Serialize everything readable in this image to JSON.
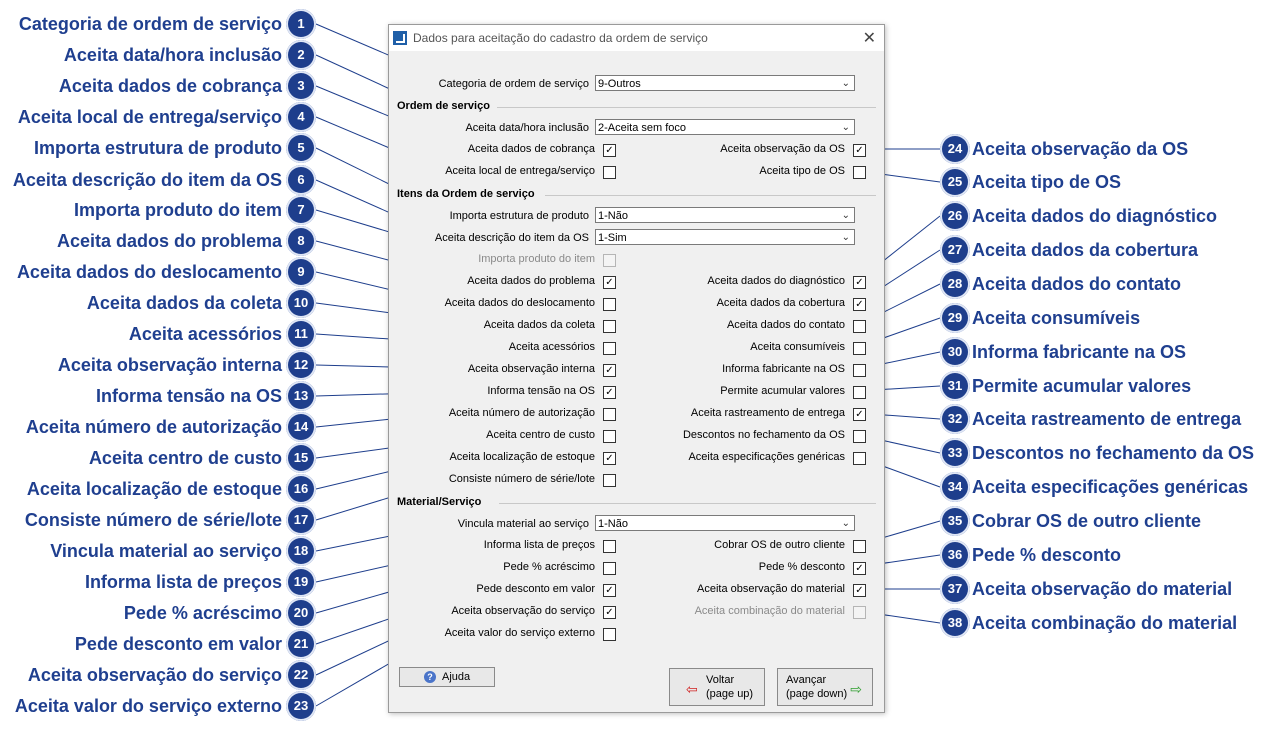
{
  "dialog": {
    "title": "Dados para aceitação do cadastro da ordem de serviço",
    "close_glyph": "✕",
    "category_label": "Categoria de ordem de serviço",
    "category_value": "9-Outros",
    "section_ordem": "Ordem de serviço",
    "section_itens": "Itens da Ordem de serviço",
    "section_material": "Material/Serviço",
    "datahora_label": "Aceita data/hora inclusão",
    "datahora_value": "2-Aceita sem foco",
    "importa_estrutura_label": "Importa estrutura de produto",
    "importa_estrutura_value": "1-Não",
    "aceita_descricao_label": "Aceita descrição do item da OS",
    "aceita_descricao_value": "1-Sim",
    "vincula_label": "Vincula material ao serviço",
    "vincula_value": "1-Não",
    "left_checks": [
      {
        "label": "Aceita dados de cobrança",
        "checked": true
      },
      {
        "label": "Aceita local de entrega/serviço",
        "checked": false
      },
      {
        "label": "Importa produto do item",
        "checked": false,
        "disabled": true
      },
      {
        "label": "Aceita dados do problema",
        "checked": true
      },
      {
        "label": "Aceita dados do deslocamento",
        "checked": false
      },
      {
        "label": "Aceita dados da coleta",
        "checked": false
      },
      {
        "label": "Aceita acessórios",
        "checked": false
      },
      {
        "label": "Aceita observação interna",
        "checked": true
      },
      {
        "label": "Informa tensão na OS",
        "checked": true
      },
      {
        "label": "Aceita número de autorização",
        "checked": false
      },
      {
        "label": "Aceita centro de custo",
        "checked": false
      },
      {
        "label": "Aceita localização de estoque",
        "checked": true
      },
      {
        "label": "Consiste número de série/lote",
        "checked": false
      },
      {
        "label": "Informa lista de preços",
        "checked": false
      },
      {
        "label": "Pede % acréscimo",
        "checked": false
      },
      {
        "label": "Pede desconto em valor",
        "checked": true
      },
      {
        "label": "Aceita observação do serviço",
        "checked": true
      },
      {
        "label": "Aceita valor do serviço externo",
        "checked": false
      }
    ],
    "right_checks": [
      {
        "label": "Aceita observação da OS",
        "checked": true
      },
      {
        "label": "Aceita tipo de OS",
        "checked": false
      },
      {
        "label": "Aceita dados do diagnóstico",
        "checked": true
      },
      {
        "label": "Aceita dados da cobertura",
        "checked": true
      },
      {
        "label": "Aceita dados do contato",
        "checked": false
      },
      {
        "label": "Aceita consumíveis",
        "checked": false
      },
      {
        "label": "Informa fabricante na OS",
        "checked": false
      },
      {
        "label": "Permite acumular valores",
        "checked": false
      },
      {
        "label": "Aceita rastreamento de entrega",
        "checked": true
      },
      {
        "label": "Descontos no fechamento da OS",
        "checked": false
      },
      {
        "label": "Aceita especificações genéricas",
        "checked": false
      },
      {
        "label": "Cobrar OS de outro cliente",
        "checked": false
      },
      {
        "label": "Pede % desconto",
        "checked": true
      },
      {
        "label": "Aceita observação do material",
        "checked": true
      },
      {
        "label": "Aceita combinação do material",
        "checked": false,
        "disabled": true
      }
    ],
    "help_button": "Ajuda",
    "back_button_line1": "Voltar",
    "back_button_line2": "(page up)",
    "next_button_line1": "Avançar",
    "next_button_line2": "(page down)"
  },
  "annotations_left": [
    "Categoria de ordem de serviço",
    "Aceita data/hora inclusão",
    "Aceita dados de cobrança",
    "Aceita local de entrega/serviço",
    "Importa estrutura de produto",
    "Aceita descrição do item da OS",
    "Importa produto do item",
    "Aceita dados do problema",
    "Aceita dados do deslocamento",
    "Aceita dados da coleta",
    "Aceita acessórios",
    "Aceita observação interna",
    "Informa tensão na OS",
    "Aceita número de autorização",
    "Aceita centro de custo",
    "Aceita localização de estoque",
    "Consiste número de série/lote",
    "Vincula material ao serviço",
    "Informa lista de preços",
    "Pede % acréscimo",
    "Pede desconto em valor",
    "Aceita observação do serviço",
    "Aceita valor do serviço externo"
  ],
  "annotations_right": [
    "Aceita observação da OS",
    "Aceita tipo de OS",
    "Aceita dados do diagnóstico",
    "Aceita dados da cobertura",
    "Aceita dados do contato",
    "Aceita consumíveis",
    "Informa fabricante na OS",
    "Permite acumular valores",
    "Aceita rastreamento de entrega",
    "Descontos no fechamento da OS",
    "Aceita especificações genéricas",
    "Cobrar OS de outro cliente",
    "Pede % desconto",
    "Aceita observação do material",
    "Aceita combinação do material"
  ],
  "colors": {
    "annotation_text": "#1f3f8f",
    "badge": "#1e3e8c",
    "leader_line": "#1e3e8c"
  }
}
